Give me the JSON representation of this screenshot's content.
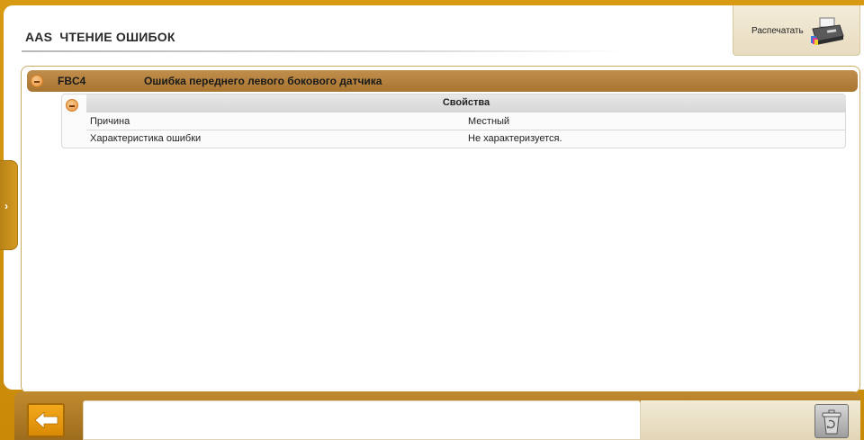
{
  "header": {
    "title": "AAS  ЧТЕНИЕ ОШИБОК",
    "print_label": "Распечатать"
  },
  "error": {
    "code": "FBC4",
    "description": "Ошибка переднего левого бокового датчика",
    "properties": {
      "title": "Свойства",
      "rows": [
        {
          "key": "Причина",
          "value": "Местный"
        },
        {
          "key": "Характеристика ошибки",
          "value": "Не характеризуется."
        }
      ]
    }
  },
  "icons": {
    "print": "printer-icon",
    "collapse": "minus-icon",
    "side": "chevron-right-icon",
    "back": "back-arrow-icon",
    "trash": "trash-icon"
  },
  "colors": {
    "frame": "#d4960f",
    "error_row": "#b07d3a",
    "accent": "#e8923b"
  }
}
